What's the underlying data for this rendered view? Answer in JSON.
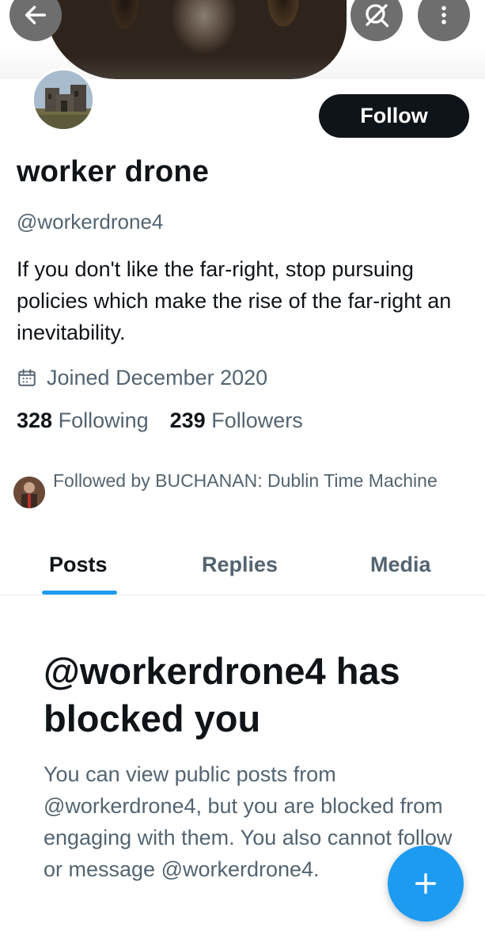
{
  "profile": {
    "display_name": "worker drone",
    "handle": "@workerdrone4",
    "bio": "If you don't like the far-right, stop pursuing policies which make the rise of the far-right an inevitability.",
    "joined": "Joined December 2020",
    "following_count": "328",
    "following_label": "Following",
    "followers_count": "239",
    "followers_label": "Followers",
    "followed_by": "Followed by BUCHANAN: Dublin Time Machine"
  },
  "actions": {
    "follow_label": "Follow"
  },
  "tabs": [
    {
      "label": "Posts",
      "selected": true
    },
    {
      "label": "Replies",
      "selected": false
    },
    {
      "label": "Media",
      "selected": false
    }
  ],
  "blocked": {
    "title": "@workerdrone4 has blocked you",
    "body": "You can view public posts from @workerdrone4, but you are blocked from engaging with them. You also cannot follow or message @workerdrone4."
  },
  "icons": {
    "back": "back-arrow-icon",
    "no_search": "search-off-icon",
    "more": "more-vertical-icon",
    "calendar": "calendar-icon",
    "compose": "plus-icon"
  },
  "colors": {
    "accent": "#1d9bf0",
    "text_primary": "#0f1419",
    "text_secondary": "#536471",
    "follow_button": "#0f1419"
  }
}
